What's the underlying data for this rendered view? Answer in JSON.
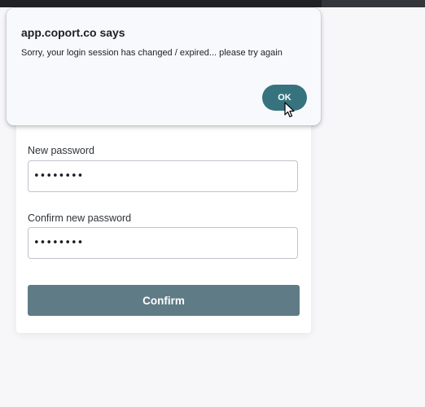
{
  "dialog": {
    "title": "app.coport.co says",
    "message": "Sorry, your login session has changed / expired... please try again",
    "ok_label": "OK"
  },
  "form": {
    "new_password_label": "New password",
    "new_password_value": "••••••••",
    "confirm_password_label": "Confirm new password",
    "confirm_password_value": "••••••••",
    "confirm_label": "Confirm"
  },
  "colors": {
    "accent": "#37737f",
    "confirm_button": "#5f7b85",
    "background": "#f7f6f9"
  },
  "icons": {
    "cursor": "mouse-pointer-icon"
  }
}
